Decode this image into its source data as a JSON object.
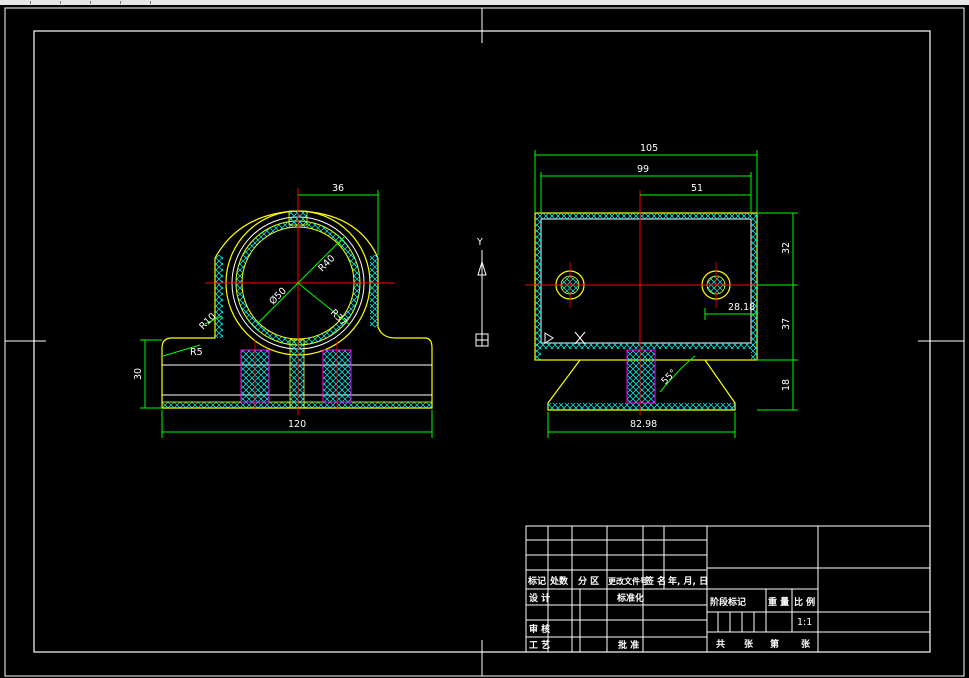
{
  "front_view": {
    "dims": {
      "top_width": "36",
      "r40": "R40",
      "r37": "R37",
      "d50": "Ø50",
      "r10": "R10",
      "r5": "R5",
      "height": "30",
      "width": "120"
    }
  },
  "side_view": {
    "dims": {
      "overall": "105",
      "inner": "99",
      "half": "51",
      "hole_offset": "28.18",
      "h_top": "32",
      "h_mid": "37",
      "h_base": "18",
      "angle": "55°",
      "base_width": "82.98"
    }
  },
  "ucs": {
    "label": "Y"
  },
  "title_block": {
    "row_headers": [
      "标记",
      "处数",
      "分 区",
      "更改文件号",
      "签 名",
      "年, 月, 日"
    ],
    "design": "设 计",
    "standardize": "标准化",
    "review": "审 核",
    "process": "工 艺",
    "approve": "批 准",
    "stage_mark": "阶段标记",
    "weight": "重 量",
    "scale_label": "比 例",
    "scale_value": "1:1",
    "total": "共",
    "sheets": "张",
    "sheet_no": "第",
    "sheet_unit": "张"
  },
  "colors": {
    "outline": "#ffff00",
    "dimension": "#00ff00",
    "center": "#ff0000",
    "border": "#ffffff",
    "hatch": "#00ffff",
    "thread": "#ff00ff",
    "background": "#000000"
  }
}
